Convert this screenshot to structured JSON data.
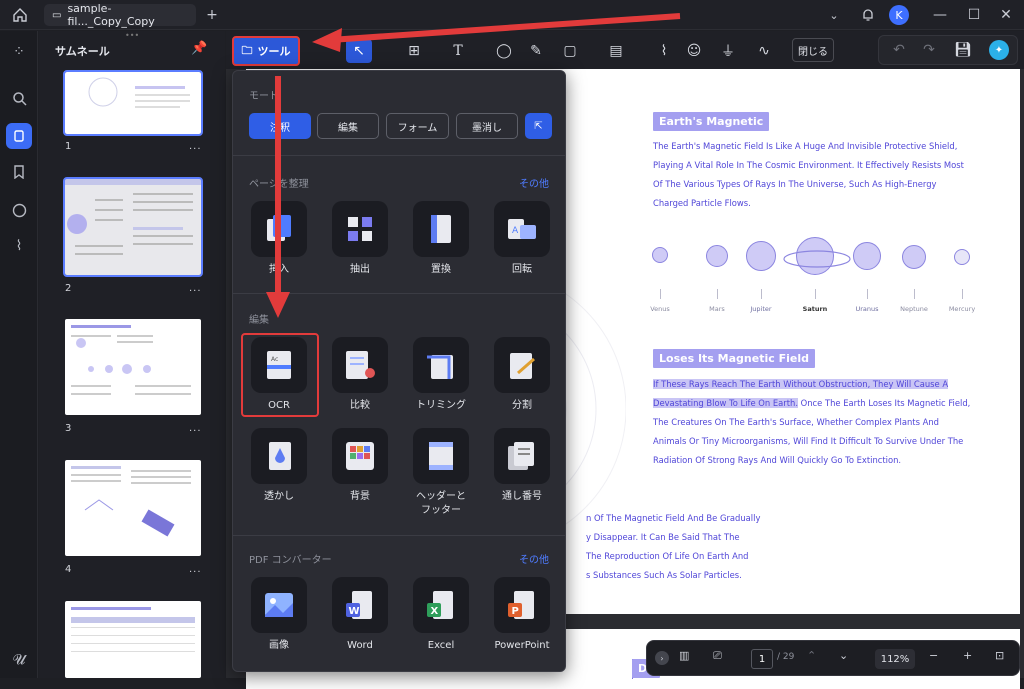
{
  "titlebar": {
    "tab_title": "sample-fil..._Copy_Copy",
    "avatar_initial": "K"
  },
  "thumbs": {
    "title": "サムネール",
    "pages": [
      "1",
      "2",
      "3",
      "4"
    ],
    "more": "..."
  },
  "toolbar": {
    "tools_label": "ツール",
    "close_label": "閉じる"
  },
  "menu": {
    "mode_header": "モード",
    "modes": [
      "注釈",
      "編集",
      "フォーム",
      "墨消し"
    ],
    "organize_header": "ページを整理",
    "organize_more": "その他",
    "organize_items": [
      "挿入",
      "抽出",
      "置換",
      "回転"
    ],
    "edit_header": "編集",
    "edit_items": [
      "OCR",
      "比較",
      "トリミング",
      "分割",
      "透かし",
      "背景",
      "ヘッダーと\nフッター",
      "通し番号"
    ],
    "convert_header": "PDF コンバーター",
    "convert_more": "その他",
    "convert_items": [
      "画像",
      "Word",
      "Excel",
      "PowerPoint"
    ]
  },
  "document": {
    "title1": "Earth's Magnetic",
    "para1": "The Earth's Magnetic Field Is Like A Huge And Invisible Protective Shield, Playing A Vital Role In The Cosmic Environment. It Effectively Resists Most Of The Various Types Of Rays In The Universe, Such As High-Energy Charged Particle Flows.",
    "planets": [
      "Venus",
      "Mars",
      "Jupiter",
      "Saturn",
      "Uranus",
      "Neptune",
      "Mercury"
    ],
    "title2": "Loses Its Magnetic Field",
    "para2_hl": "If These Rays Reach The Earth Without Obstruction, They Will Cause A Devastating Blow To Life On Earth.",
    "para2_rest": " Once The Earth Loses Its Magnetic Field, The Creatures On The Earth's Surface, Whether Complex Plants And Animals Or Tiny Microorganisms, Will Find It Difficult To Survive Under The Radiation Of Strong Rays And Will Quickly Go To Extinction.",
    "partial_lines": [
      "n Of The Magnetic Field And Be Gradually",
      "y Disappear. It Can Be Said That The",
      "The Reproduction Of Life On Earth And",
      "s Substances Such As Solar Particles."
    ],
    "next_page_label": "Dy"
  },
  "bottombar": {
    "current_page": "1",
    "total_pages": "/ 29",
    "zoom": "112%"
  }
}
